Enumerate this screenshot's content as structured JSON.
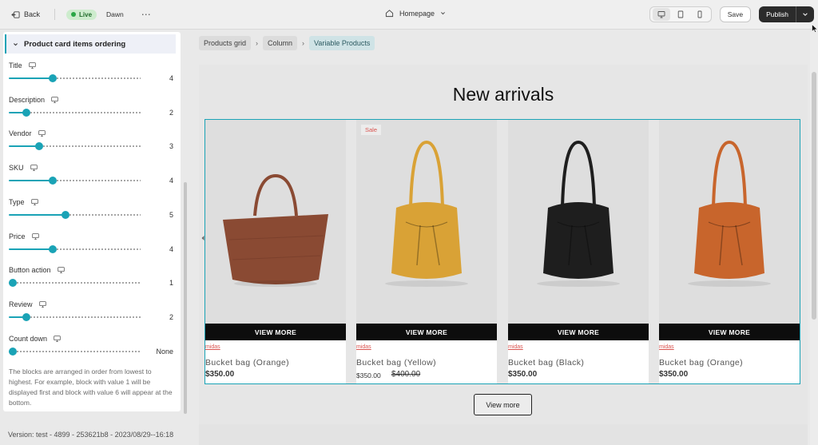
{
  "topbar": {
    "back_label": "Back",
    "live_label": "Live",
    "theme_name": "Dawn",
    "page_selector": "Homepage",
    "save_label": "Save",
    "publish_label": "Publish"
  },
  "sidebar": {
    "section_title": "Product card items ordering",
    "settings": [
      {
        "label": "Title",
        "value": "4",
        "position": 0.333
      },
      {
        "label": "Description",
        "value": "2",
        "position": 0.133
      },
      {
        "label": "Vendor",
        "value": "3",
        "position": 0.233
      },
      {
        "label": "SKU",
        "value": "4",
        "position": 0.333
      },
      {
        "label": "Type",
        "value": "5",
        "position": 0.433
      },
      {
        "label": "Price",
        "value": "4",
        "position": 0.333
      },
      {
        "label": "Button action",
        "value": "1",
        "position": 0.033
      },
      {
        "label": "Review",
        "value": "2",
        "position": 0.133
      },
      {
        "label": "Count down",
        "value": "None",
        "position": 0.033
      }
    ],
    "help_text": "The blocks are arranged in order from lowest to highest. For example, block with value 1 will be displayed first and block with value 6 will appear at the bottom."
  },
  "version": "Version: test - 4899 - 253621b8 - 2023/08/29--16:18",
  "breadcrumb": [
    "Products grid",
    "Column",
    "Variable Products"
  ],
  "canvas": {
    "section_title": "New arrivals",
    "cta_label": "VIEW MORE",
    "view_more_label": "View more",
    "products": [
      {
        "name": "Bucket bag (Orange)",
        "vendor": "midas",
        "price": "$350.00",
        "compare_price": "",
        "sale": "",
        "bag_color": "#8a4a33",
        "style": "woven"
      },
      {
        "name": "Bucket bag (Yellow)",
        "vendor": "midas",
        "price": "$350.00",
        "compare_price": "$400.00",
        "sale": "Sale",
        "bag_color": "#d9a236",
        "style": "bucket"
      },
      {
        "name": "Bucket bag (Black)",
        "vendor": "midas",
        "price": "$350.00",
        "compare_price": "",
        "sale": "",
        "bag_color": "#1e1e1e",
        "style": "bucket"
      },
      {
        "name": "Bucket bag (Orange)",
        "vendor": "midas",
        "price": "$350.00",
        "compare_price": "",
        "sale": "",
        "bag_color": "#c8652c",
        "style": "bucket"
      }
    ]
  },
  "colors": {
    "accent": "#1aa3b6",
    "sale_red": "#d9534f",
    "live_green": "#29a745",
    "publish_dark": "#2b2b2b"
  },
  "icons": [
    "back-icon",
    "home-icon",
    "desktop-icon",
    "tablet-icon",
    "mobile-icon",
    "chevron-down-icon",
    "monitor-icon"
  ]
}
